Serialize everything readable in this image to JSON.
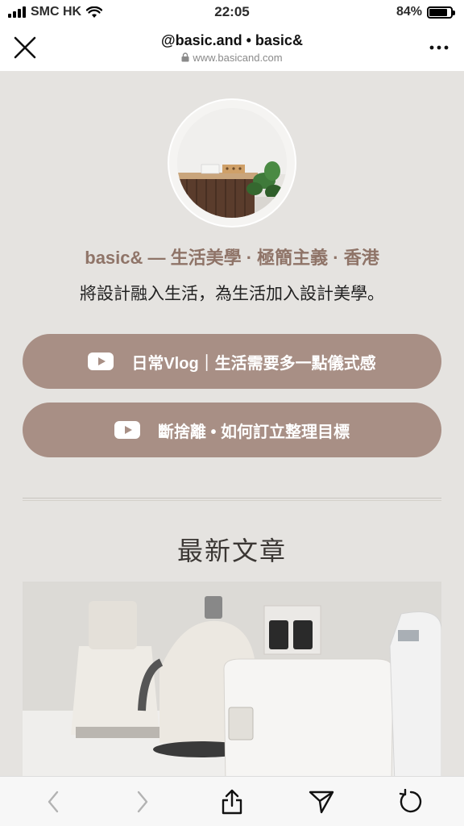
{
  "status": {
    "carrier": "SMC HK",
    "time": "22:05",
    "battery": "84%",
    "battery_level": 0.84
  },
  "browser": {
    "title": "@basic.and • basic&",
    "url": "www.basicand.com"
  },
  "profile": {
    "name": "basic& — 生活美學 · 極簡主義 · 香港",
    "bio": "將設計融入生活，為生活加入設計美學。"
  },
  "links": [
    {
      "label": "日常Vlog｜生活需要多一點儀式感",
      "icon": "youtube-icon"
    },
    {
      "label": "斷捨離 • 如何訂立整理目標",
      "icon": "youtube-icon"
    }
  ],
  "section": {
    "title": "最新文章"
  },
  "colors": {
    "accent": "#a88f85",
    "name": "#8f7468",
    "background": "#e5e3e0"
  }
}
